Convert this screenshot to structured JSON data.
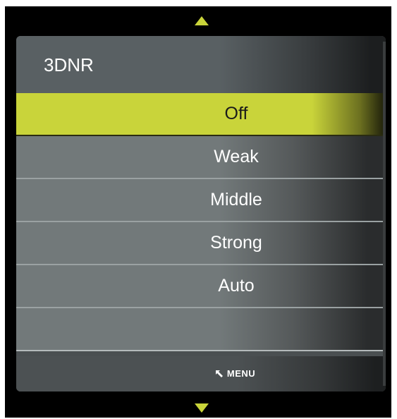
{
  "header": {
    "title": "3DNR"
  },
  "options": [
    {
      "label": "Off",
      "selected": true
    },
    {
      "label": "Weak",
      "selected": false
    },
    {
      "label": "Middle",
      "selected": false
    },
    {
      "label": "Strong",
      "selected": false
    },
    {
      "label": "Auto",
      "selected": false
    },
    {
      "label": "",
      "selected": false
    }
  ],
  "footer": {
    "menu_label": "MENU",
    "back_icon": "return-arrow-icon"
  },
  "nav": {
    "up_icon": "triangle-up-icon",
    "down_icon": "triangle-down-icon"
  },
  "colors": {
    "accent": "#c9d43a",
    "background": "#000000",
    "panel": "#4a4f51",
    "option": "#72797a"
  }
}
